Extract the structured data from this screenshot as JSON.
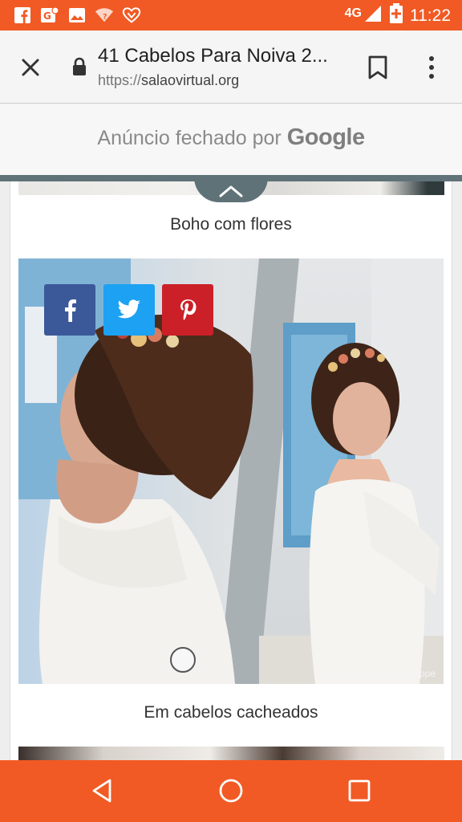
{
  "statusbar": {
    "network": "4G",
    "time": "11:22",
    "icons": [
      "facebook-icon",
      "google-news-icon",
      "gallery-icon",
      "wifi-question-icon",
      "love-heart-icon",
      "signal-icon",
      "battery-charging-icon"
    ]
  },
  "toolbar": {
    "title": "41 Cabelos Para Noiva 2...",
    "url_scheme": "https://",
    "url_host": "salaovirtual.org"
  },
  "ad": {
    "text": "Anúncio fechado por",
    "brand": "Google"
  },
  "article": {
    "caption_1": "Boho com flores",
    "caption_2": "Em cabelos cacheados",
    "watermark": "© Instagram, @leshneppe"
  },
  "colors": {
    "status_bar": "#f15a24",
    "nav_bar": "#f15a24",
    "facebook": "#3b5998",
    "twitter": "#1da1f2",
    "pinterest": "#cb2027",
    "collapse": "#5f7278"
  }
}
